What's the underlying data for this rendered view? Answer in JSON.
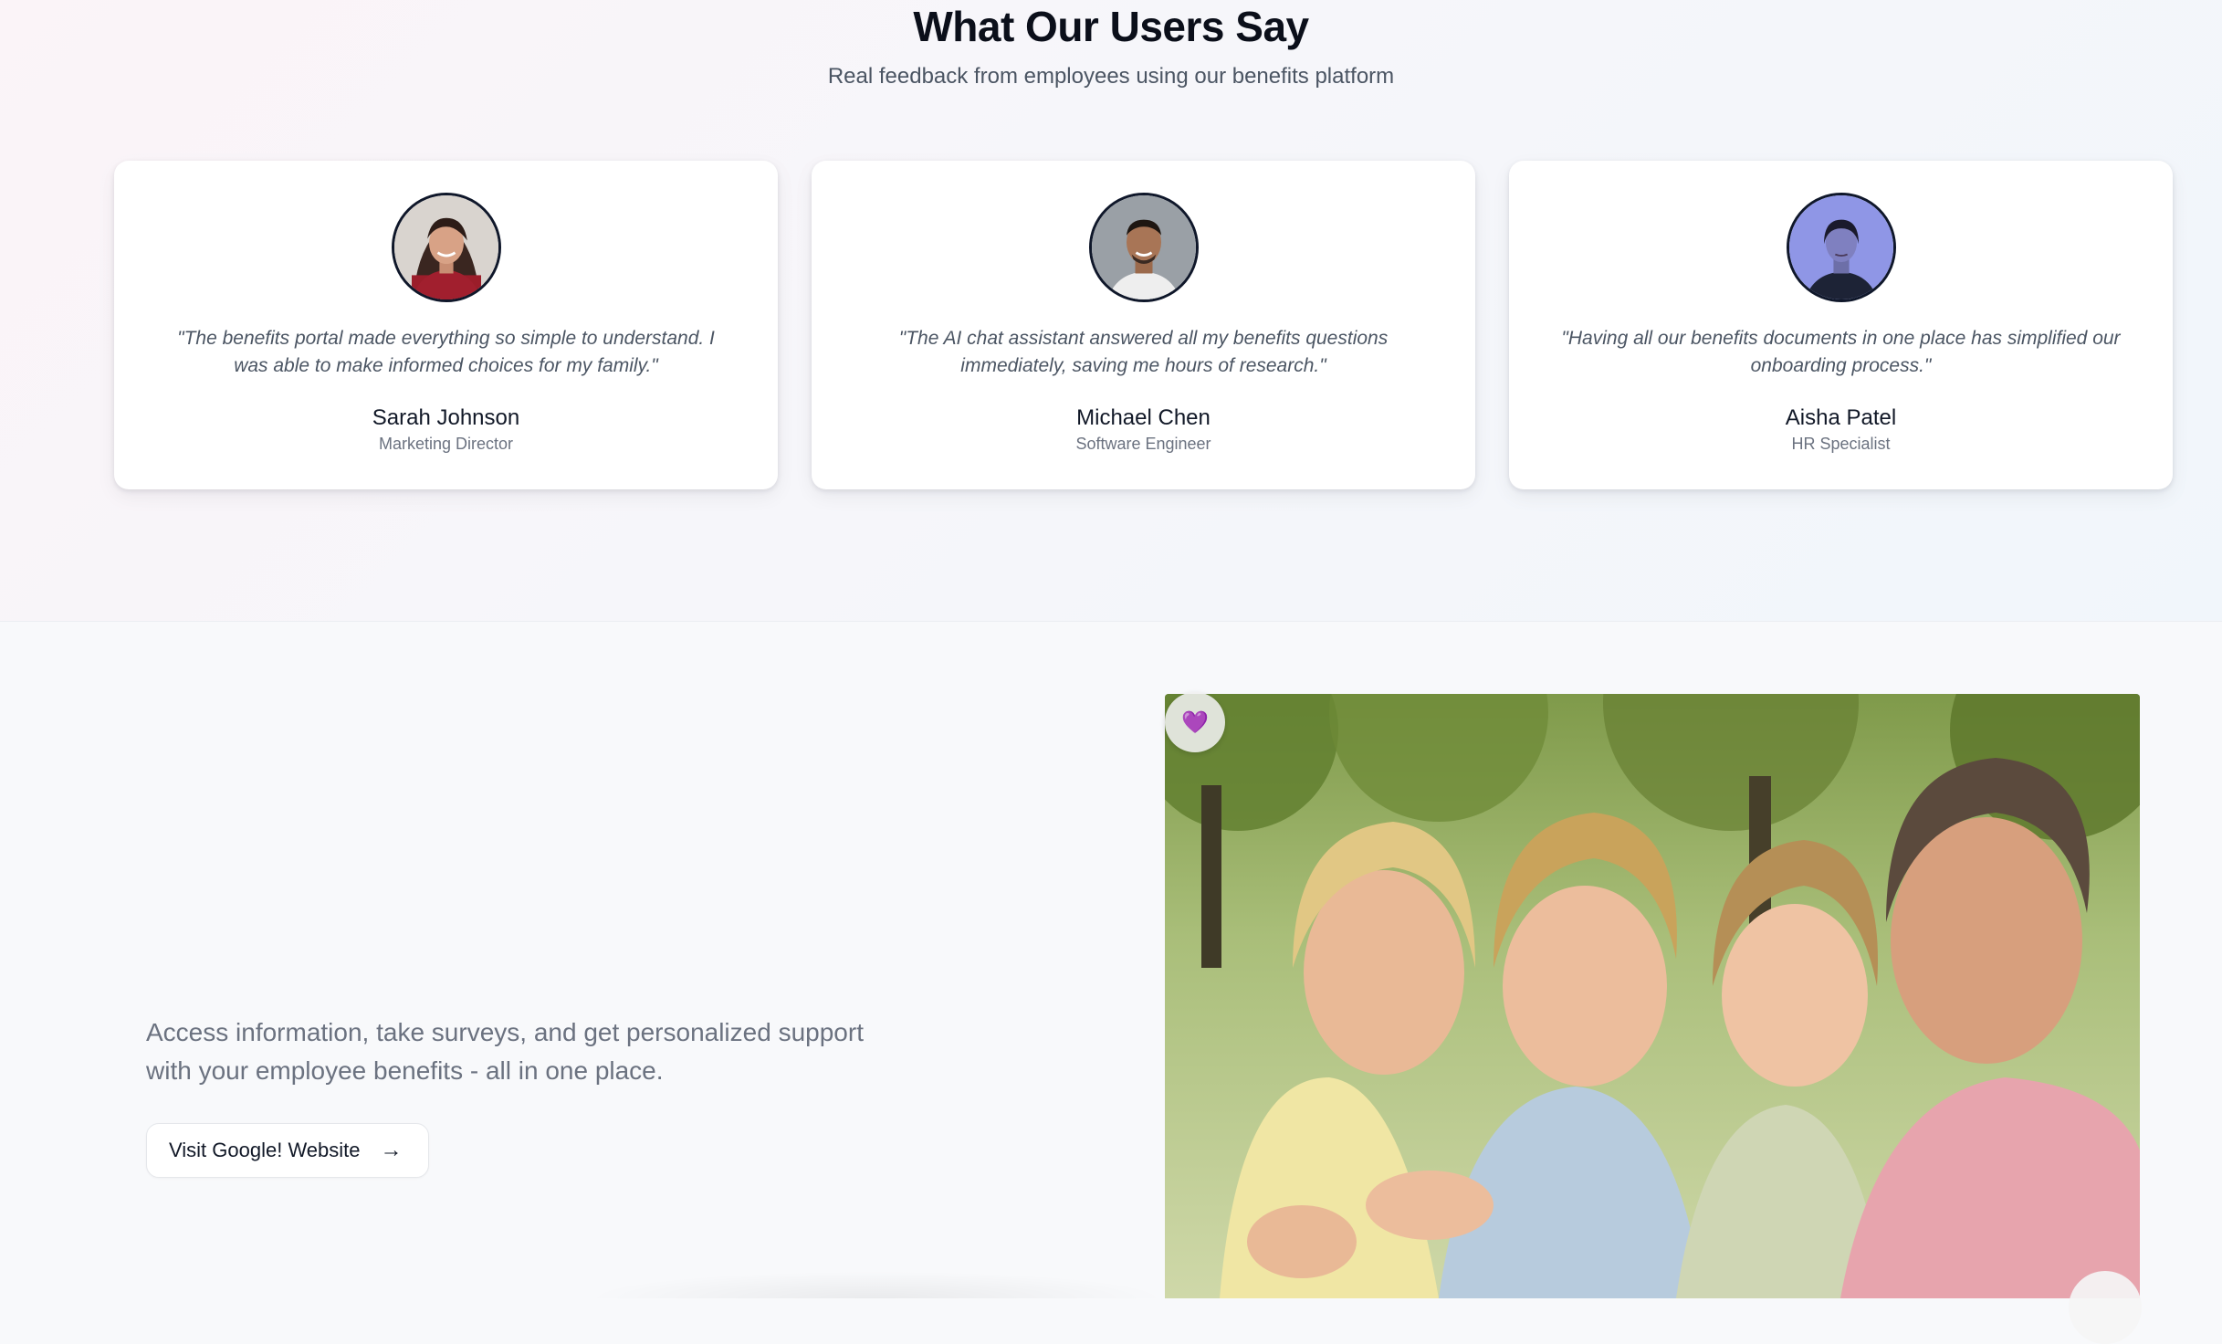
{
  "testimonials": {
    "title": "What Our Users Say",
    "subtitle": "Real feedback from employees using our benefits platform",
    "items": [
      {
        "quote": "\"The benefits portal made everything so simple to understand. I was able to make informed choices for my family.\"",
        "name": "Sarah Johnson",
        "role": "Marketing Director"
      },
      {
        "quote": "\"The AI chat assistant answered all my benefits questions immediately, saving me hours of research.\"",
        "name": "Michael Chen",
        "role": "Software Engineer"
      },
      {
        "quote": "\"Having all our benefits documents in one place has simplified our onboarding process.\"",
        "name": "Aisha Patel",
        "role": "HR Specialist"
      }
    ]
  },
  "hero": {
    "description": "Access information, take surveys, and get personalized support with your employee benefits - all in one place.",
    "visit_button_label": "Visit Google! Website",
    "visit_button_icon": "arrow-right-icon",
    "badge_icon": "purple-heart-icon"
  },
  "colors": {
    "heading": "#0b0f1a",
    "body_text": "#4b5563",
    "muted_text": "#6b7280",
    "card_bg": "#ffffff",
    "page_bg": "#f8f9fb"
  }
}
